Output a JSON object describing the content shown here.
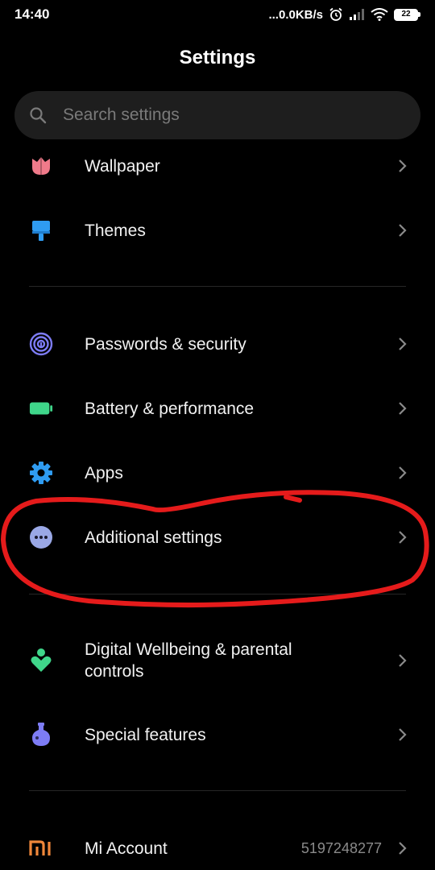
{
  "status": {
    "time": "14:40",
    "speed": "...0.0KB/s",
    "battery": "22"
  },
  "header": {
    "title": "Settings"
  },
  "search": {
    "placeholder": "Search settings"
  },
  "items": [
    {
      "label": "Wallpaper",
      "icon": "wallpaper-icon",
      "color": "#f07a8a"
    },
    {
      "label": "Themes",
      "icon": "themes-icon",
      "color": "#2f9cf2"
    },
    {
      "label": "Passwords & security",
      "icon": "fingerprint-icon",
      "color": "#7d7cf5"
    },
    {
      "label": "Battery & performance",
      "icon": "battery-icon",
      "color": "#3fd68a"
    },
    {
      "label": "Apps",
      "icon": "gear-icon",
      "color": "#2f9cf2"
    },
    {
      "label": "Additional settings",
      "icon": "more-dots-icon",
      "color": "#9aa8e6"
    },
    {
      "label": "Digital Wellbeing & parental controls",
      "icon": "wellbeing-icon",
      "color": "#3fd68a"
    },
    {
      "label": "Special features",
      "icon": "flask-icon",
      "color": "#7d7cf5"
    },
    {
      "label": "Mi Account",
      "icon": "mi-logo-icon",
      "color": "#f0873a",
      "value": "5197248277"
    }
  ],
  "annotation": {
    "color": "#e51b1b"
  }
}
